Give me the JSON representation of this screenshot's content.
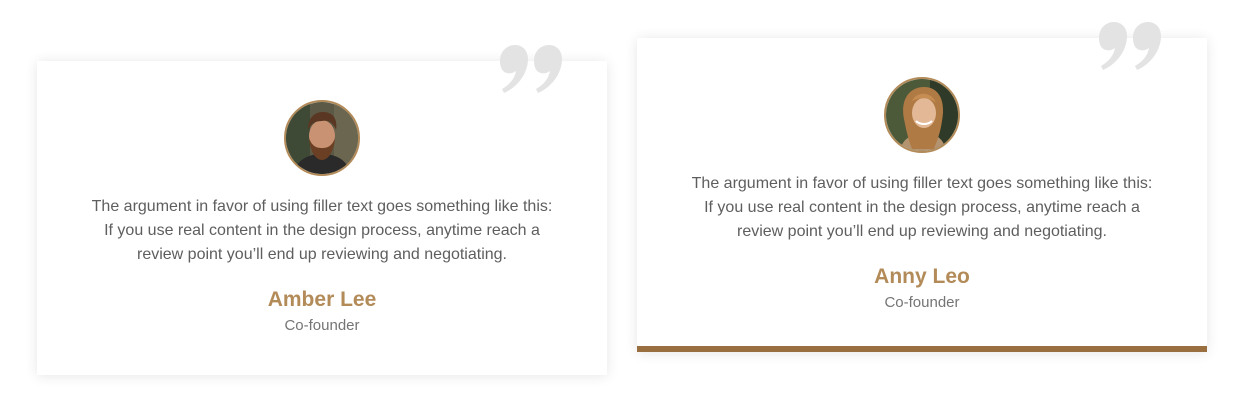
{
  "colors": {
    "accent": "#b38b59",
    "accent_bar": "#9a6f40",
    "quote_icon": "#e3e3e3",
    "text": "#5e5e5e",
    "role_text": "#757575"
  },
  "testimonials": [
    {
      "avatar_icon": "bearded-man-portrait",
      "quote_lines": [
        "The argument in favor of using filler text goes something like this:",
        "If you use real content in the design process, anytime reach a",
        "review point you’ll end up reviewing and negotiating."
      ],
      "name": "Amber Lee",
      "role": "Co-founder"
    },
    {
      "avatar_icon": "smiling-woman-portrait",
      "quote_lines": [
        "The argument in favor of using filler text goes something like this:",
        "If you use real content in the design process, anytime reach a",
        "review point you’ll end up reviewing and negotiating."
      ],
      "name": "Anny Leo",
      "role": "Co-founder"
    }
  ]
}
